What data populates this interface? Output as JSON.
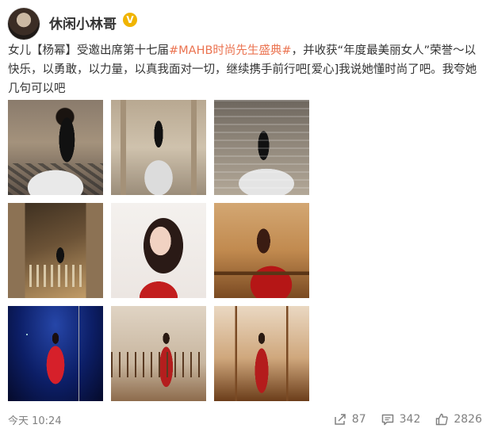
{
  "user": {
    "name": "休闲小林哥",
    "badge": "V"
  },
  "post": {
    "text_before": "女儿【杨幂】受邀出席第十七届",
    "hashtag": "#MAHB时尚先生盛典#",
    "text_after": "，并收获“年度最美丽女人”荣誉～以快乐，以勇敢，以力量，以真我面对一切，继续携手前行吧[爱心]我说她懂时尚了吧。我夸她几句可以吧"
  },
  "footer": {
    "timestamp": "今天 10:24",
    "repost_count": "87",
    "comment_count": "342",
    "like_count": "2826"
  },
  "colors": {
    "link": "#eb7350",
    "text": "#333333",
    "muted": "#808080",
    "badge": "#f0b400"
  },
  "icons": {
    "repost": "share-arrow-icon",
    "comment": "comment-bubble-icon",
    "like": "thumbs-up-icon"
  }
}
